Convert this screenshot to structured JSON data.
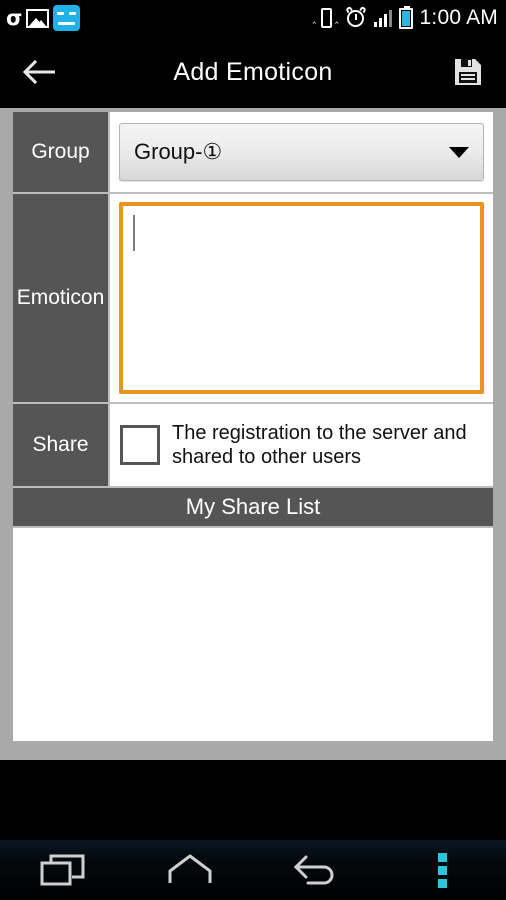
{
  "status_bar": {
    "icons_left": [
      "sigma-icon",
      "picture-icon",
      "face-icon"
    ],
    "icons_right": [
      "vibrate-icon",
      "alarm-icon",
      "signal-icon",
      "battery-icon"
    ],
    "time": "1:00 AM"
  },
  "title_bar": {
    "back_icon": "back-arrow-icon",
    "title": "Add Emoticon",
    "save_icon": "save-floppy-icon"
  },
  "form": {
    "group": {
      "label": "Group",
      "selected_value": "Group-①"
    },
    "emoticon": {
      "label": "Emoticon",
      "value": "",
      "focused": true,
      "border_color": "#e8941e"
    },
    "share": {
      "label": "Share",
      "checkbox_checked": false,
      "checkbox_label": "The registration to the server and shared to other users"
    }
  },
  "share_list": {
    "header": "My Share List",
    "items": []
  },
  "nav_bar": {
    "buttons": [
      {
        "name": "recents",
        "icon": "recents-icon"
      },
      {
        "name": "home",
        "icon": "home-icon"
      },
      {
        "name": "back",
        "icon": "back-icon"
      },
      {
        "name": "menu",
        "icon": "overflow-menu-icon"
      }
    ],
    "menu_color": "#2ec4de"
  },
  "colors": {
    "page_background": "#a9a9a9",
    "label_cell": "#555555",
    "accent_orange": "#e8941e",
    "status_accent": "#29b6dd"
  }
}
